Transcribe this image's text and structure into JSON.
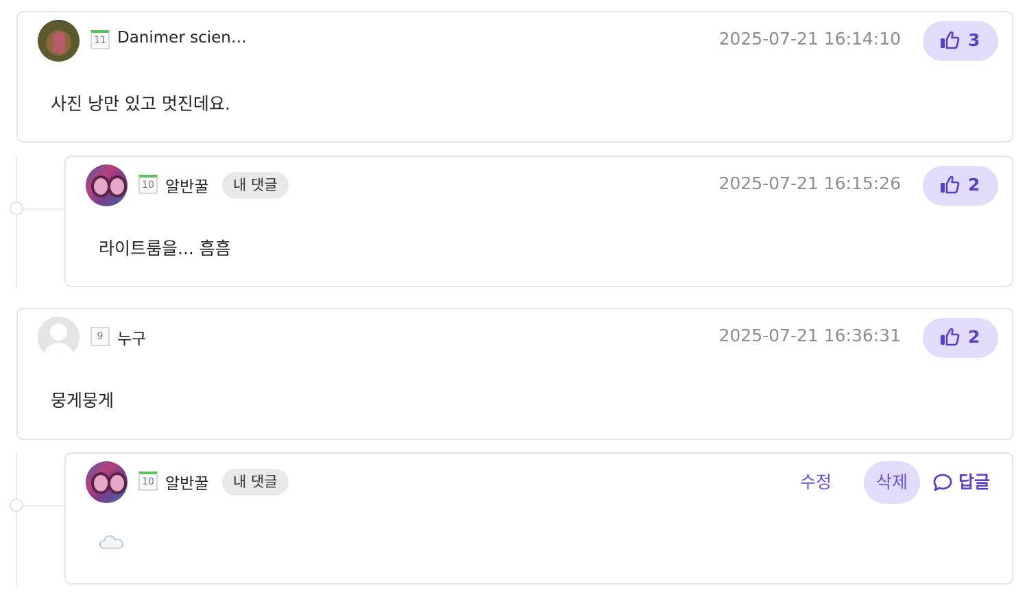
{
  "comments": [
    {
      "level": "11",
      "level_style": "green",
      "username": "Danimer scien…",
      "timestamp": "2025-07-21 16:14:10",
      "likes": "3",
      "body": "사진 낭만  있고 멋진데요."
    },
    {
      "level": "10",
      "level_style": "green",
      "username": "알반꿀",
      "my_badge": "내 댓글",
      "timestamp": "2025-07-21 16:15:26",
      "likes": "2",
      "body": "라이트룸을... 흠흠"
    },
    {
      "level": "9",
      "level_style": "plain",
      "username": "누구",
      "timestamp": "2025-07-21 16:36:31",
      "likes": "2",
      "body": "뭉게뭉게"
    },
    {
      "level": "10",
      "level_style": "green",
      "username": "알반꿀",
      "my_badge": "내 댓글",
      "edit_label": "수정",
      "delete_label": "삭제",
      "reply_label": "답글",
      "body_icon": "cloud-emoji"
    }
  ],
  "icons": {
    "like": "thumbs-up-icon",
    "reply": "speech-bubble-icon"
  },
  "colors": {
    "accent": "#5a3fc0",
    "accent_bg": "#e2dcfb",
    "timestamp": "#8d8d8d",
    "border": "#e6e6e6"
  }
}
